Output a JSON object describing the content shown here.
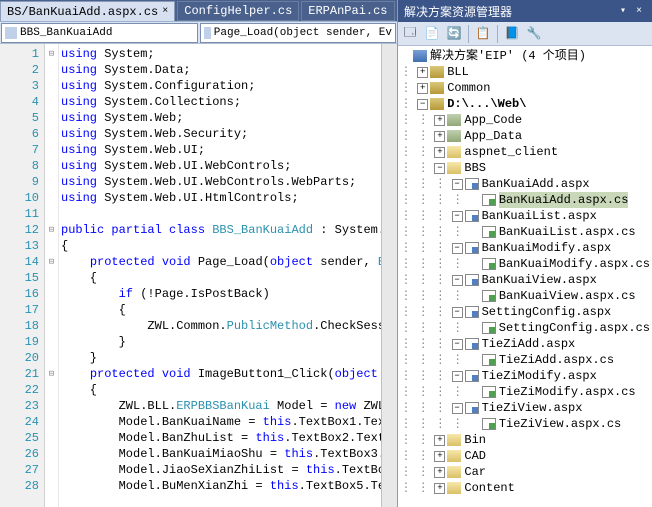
{
  "tabs": [
    {
      "label": "BS/BanKuaiAdd.aspx.cs",
      "active": true
    },
    {
      "label": "ConfigHelper.cs",
      "active": false
    },
    {
      "label": "ERPAnPai.cs",
      "active": false
    }
  ],
  "dropdowns": {
    "class": "BBS_BanKuaiAdd",
    "member": "Page_Load(object sender, Ev"
  },
  "code_lines": [
    {
      "n": 1,
      "h": "<span class='kw'>using</span> System;"
    },
    {
      "n": 2,
      "h": "<span class='kw'>using</span> System.Data;"
    },
    {
      "n": 3,
      "h": "<span class='kw'>using</span> System.Configuration;"
    },
    {
      "n": 4,
      "h": "<span class='kw'>using</span> System.Collections;"
    },
    {
      "n": 5,
      "h": "<span class='kw'>using</span> System.Web;"
    },
    {
      "n": 6,
      "h": "<span class='kw'>using</span> System.Web.Security;"
    },
    {
      "n": 7,
      "h": "<span class='kw'>using</span> System.Web.UI;"
    },
    {
      "n": 8,
      "h": "<span class='kw'>using</span> System.Web.UI.WebControls;"
    },
    {
      "n": 9,
      "h": "<span class='kw'>using</span> System.Web.UI.WebControls.WebParts;"
    },
    {
      "n": 10,
      "h": "<span class='kw'>using</span> System.Web.UI.HtmlControls;"
    },
    {
      "n": 11,
      "h": ""
    },
    {
      "n": 12,
      "h": "<span class='kw'>public partial class</span> <span class='typ'>BBS_BanKuaiAdd</span> : System."
    },
    {
      "n": 13,
      "h": "{"
    },
    {
      "n": 14,
      "h": "    <span class='kw'>protected void</span> Page_Load(<span class='kw'>object</span> sender, <span class='typ'>E</span>"
    },
    {
      "n": 15,
      "h": "    {"
    },
    {
      "n": 16,
      "h": "        <span class='kw'>if</span> (!Page.IsPostBack)"
    },
    {
      "n": 17,
      "h": "        {"
    },
    {
      "n": 18,
      "h": "            ZWL.Common.<span class='typ'>PublicMethod</span>.CheckSess"
    },
    {
      "n": 19,
      "h": "        }"
    },
    {
      "n": 20,
      "h": "    }"
    },
    {
      "n": 21,
      "h": "    <span class='kw'>protected void</span> ImageButton1_Click(<span class='kw'>object</span>"
    },
    {
      "n": 22,
      "h": "    {"
    },
    {
      "n": 23,
      "h": "        ZWL.BLL.<span class='typ'>ERPBBSBanKuai</span> Model = <span class='kw'>new</span> ZWL"
    },
    {
      "n": 24,
      "h": "        Model.BanKuaiName = <span class='kw'>this</span>.TextBox1.Tex"
    },
    {
      "n": 25,
      "h": "        Model.BanZhuList = <span class='kw'>this</span>.TextBox2.Text"
    },
    {
      "n": 26,
      "h": "        Model.BanKuaiMiaoShu = <span class='kw'>this</span>.TextBox3."
    },
    {
      "n": 27,
      "h": "        Model.JiaoSeXianZhiList = <span class='kw'>this</span>.TextBo"
    },
    {
      "n": 28,
      "h": "        Model.BuMenXianZhi = <span class='kw'>this</span>.TextBox5.Te"
    }
  ],
  "fold_marks": {
    "1": "⊟",
    "12": "⊟",
    "14": "⊟",
    "21": "⊟"
  },
  "solution_explorer": {
    "title": "解决方案资源管理器",
    "root": "解决方案'EIP' (4 个项目)",
    "projects": [
      {
        "name": "BLL",
        "exp": false
      },
      {
        "name": "Common",
        "exp": false
      }
    ],
    "web_project": "D:\\...\\Web\\",
    "web_folders_top": [
      "App_Code",
      "App_Data",
      "aspnet_client"
    ],
    "bbs_files": [
      {
        "name": "BanKuaiAdd.aspx",
        "exp": true,
        "children": [
          "BanKuaiAdd.aspx.cs"
        ],
        "sel": true
      },
      {
        "name": "BanKuaiList.aspx",
        "exp": true,
        "children": [
          "BanKuaiList.aspx.cs"
        ]
      },
      {
        "name": "BanKuaiModify.aspx",
        "exp": true,
        "children": [
          "BanKuaiModify.aspx.cs"
        ]
      },
      {
        "name": "BanKuaiView.aspx",
        "exp": true,
        "children": [
          "BanKuaiView.aspx.cs"
        ]
      },
      {
        "name": "SettingConfig.aspx",
        "exp": true,
        "children": [
          "SettingConfig.aspx.cs"
        ]
      },
      {
        "name": "TieZiAdd.aspx",
        "exp": true,
        "children": [
          "TieZiAdd.aspx.cs"
        ]
      },
      {
        "name": "TieZiModify.aspx",
        "exp": true,
        "children": [
          "TieZiModify.aspx.cs"
        ]
      },
      {
        "name": "TieZiView.aspx",
        "exp": true,
        "children": [
          "TieZiView.aspx.cs"
        ]
      }
    ],
    "web_folders_bottom": [
      "Bin",
      "CAD",
      "Car",
      "Content"
    ]
  }
}
